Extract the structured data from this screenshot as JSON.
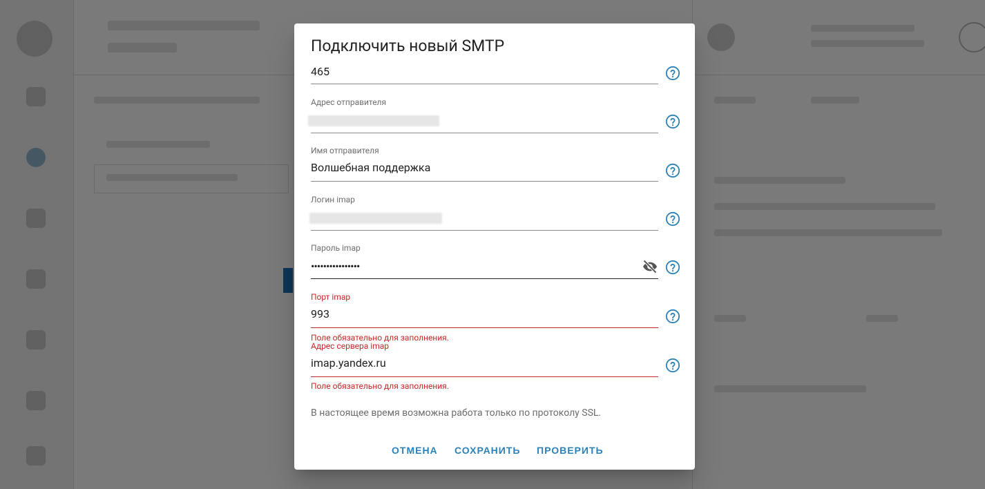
{
  "dialog": {
    "title": "Подключить новый SMTP",
    "fields": [
      {
        "label": "",
        "value": "465"
      },
      {
        "label": "Адрес отправителя",
        "value": ""
      },
      {
        "label": "Имя отправителя",
        "value": "Волшебная поддержка"
      },
      {
        "label": "Логин imap",
        "value": ""
      },
      {
        "label": "Пароль imap",
        "value": "••••••••••••••••"
      },
      {
        "label": "Порт imap",
        "value": "993",
        "error": "Поле обязательно для заполнения."
      },
      {
        "label": "Адрес сервера imap",
        "value": "imap.yandex.ru",
        "error": "Поле обязательно для заполнения."
      }
    ],
    "note": "В настоящее время возможна работа только по протоколу SSL.",
    "buttons": {
      "cancel": "ОТМЕНА",
      "save": "СОХРАНИТЬ",
      "check": "ПРОВЕРИТЬ"
    }
  },
  "icons": {
    "help": "help-circle-icon",
    "eye": "eye-off-icon"
  },
  "colors": {
    "accent": "#2a82b8",
    "error": "#c62828",
    "text": "#212121"
  }
}
